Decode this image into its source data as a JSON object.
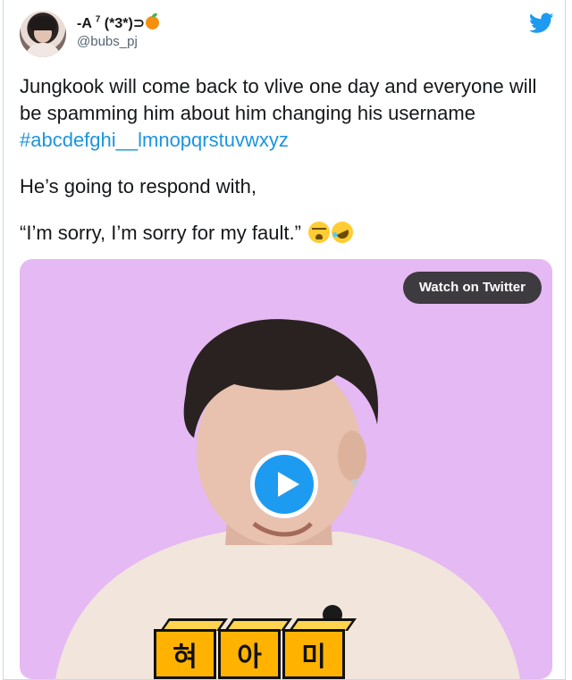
{
  "tweet": {
    "author": {
      "display_name": "-A",
      "display_name_sup": "7",
      "display_name_suffix": "(*3*)⊃",
      "handle": "@bubs_pj"
    },
    "icons": {
      "logo": "twitter-bird-icon",
      "name_emoji": "tangerine-icon"
    },
    "text_line1": "Jungkook will come back to vlive one day and everyone will be spamming him about him changing his username ",
    "hashtag": "#abcdefghi__lmnopqrstuvwxyz",
    "text_line2": "He’s going to respond with,",
    "text_line3": "“I’m sorry, I’m sorry for my fault.” ",
    "emojis": [
      "loudly-crying-face-icon",
      "rolling-on-floor-laughing-icon"
    ]
  },
  "media": {
    "watch_label": "Watch on Twitter",
    "play_icon": "play-icon",
    "caption_blocks": [
      "혀",
      "아",
      "미"
    ],
    "background_color": "#e5b9f3"
  },
  "colors": {
    "accent": "#1d9bf0",
    "hashtag": "#1b95e0",
    "text": "#14171a",
    "muted": "#536471"
  }
}
